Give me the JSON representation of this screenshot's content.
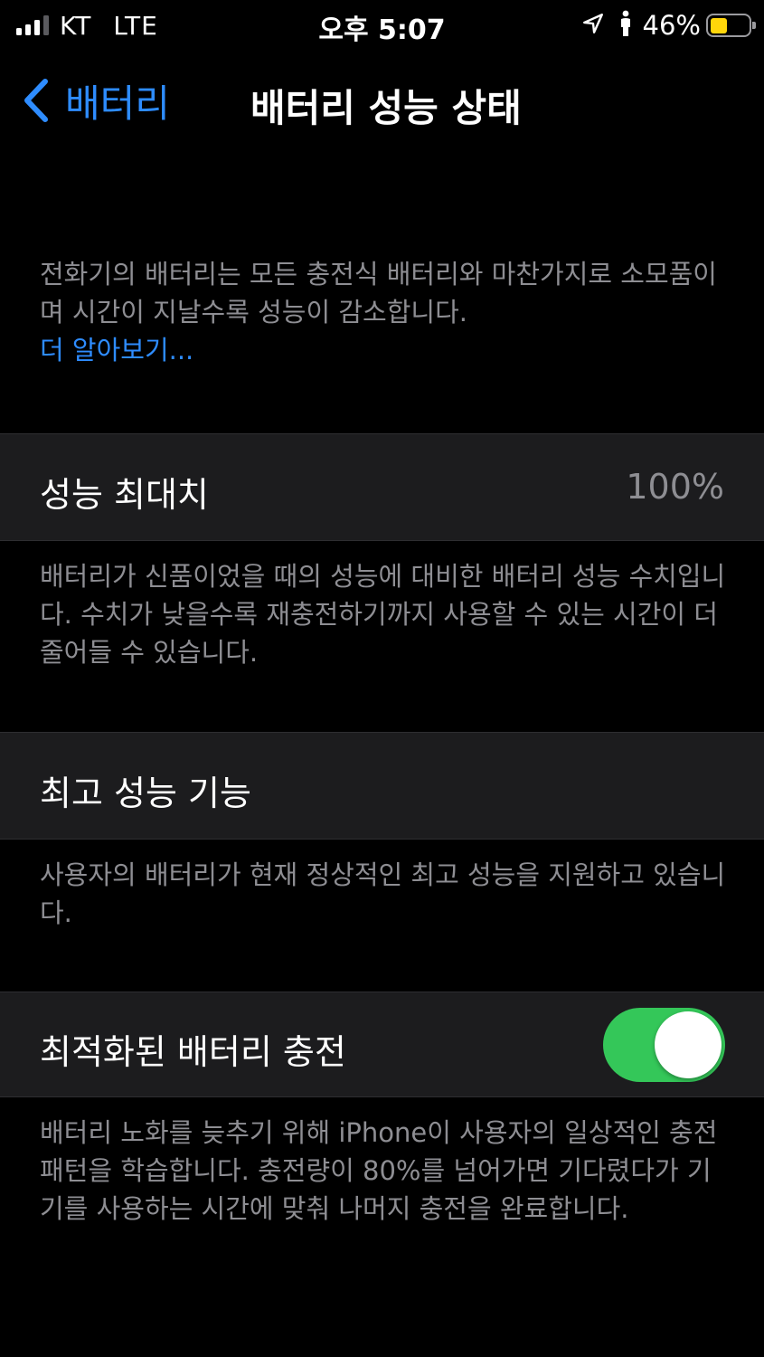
{
  "status_bar": {
    "carrier": "KT",
    "network": "LTE",
    "time": "오후 5:07",
    "battery_percent_label": "46%",
    "battery_level": 0.46,
    "signal_bars_active": 3,
    "signal_bars_total": 4,
    "battery_color": "#ffd60a"
  },
  "nav": {
    "back_label": "배터리",
    "title": "배터리 성능 상태"
  },
  "intro": {
    "text": "전화기의 배터리는 모든 충전식 배터리와 마찬가지로 소모품이며 시간이 지날수록 성능이 감소합니다.",
    "learn_more": "더 알아보기..."
  },
  "max_capacity": {
    "label": "성능 최대치",
    "value": "100%",
    "description": "배터리가 신품이었을 때의 성능에 대비한 배터리 성능 수치입니다. 수치가 낮을수록 재충전하기까지 사용할 수 있는 시간이 더 줄어들 수 있습니다."
  },
  "peak_performance": {
    "label": "최고 성능 기능",
    "description": "사용자의 배터리가 현재 정상적인 최고 성능을 지원하고 있습니다."
  },
  "optimized_charging": {
    "label": "최적화된 배터리 충전",
    "enabled": true,
    "description": "배터리 노화를 늦추기 위해 iPhone이 사용자의 일상적인 충전 패턴을 학습합니다. 충전량이 80%를 넘어가면 기다렸다가 기기를 사용하는 시간에 맞춰 나머지 충전을 완료합니다."
  },
  "colors": {
    "accent": "#2e8cff",
    "toggle_on": "#34c759",
    "cell_background": "#1c1c1e",
    "secondary_text": "#8e8e93"
  }
}
